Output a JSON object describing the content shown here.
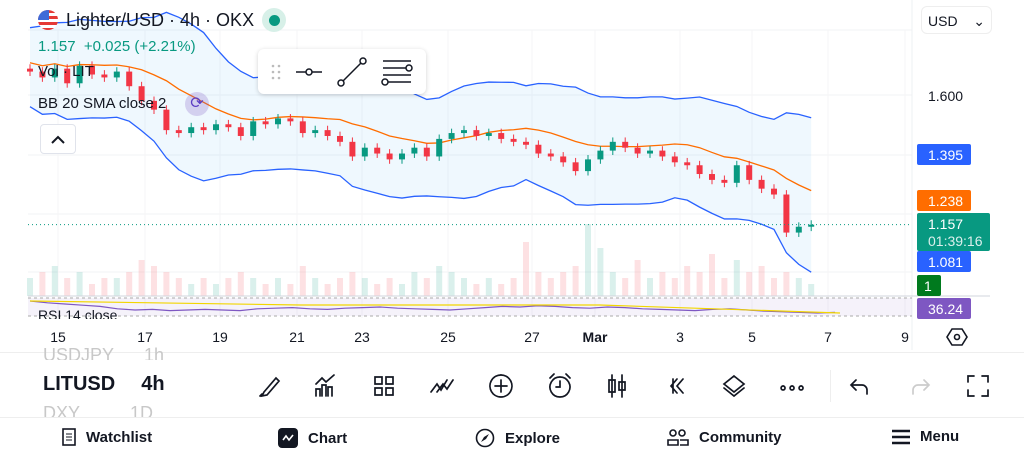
{
  "header": {
    "title": "Lighter/USD · 4h · OKX",
    "price_line": "1.157  +0.025 (+2.21%)",
    "currency": "USD"
  },
  "legends": {
    "volume": "Vol · LIT",
    "bb": "BB 20 SMA close 2",
    "rsi": "RSI 14 close"
  },
  "price_axis": {
    "labels": [
      "1.600"
    ],
    "tags": {
      "bb_upper": "1.395",
      "bb_basis": "1.238",
      "last": "1.157",
      "countdown": "01:39:16",
      "bb_lower": "1.081",
      "volume": "1",
      "rsi": "36.24"
    }
  },
  "colors": {
    "up": "#089981",
    "down": "#f23645",
    "bb_upper": "#2962ff",
    "basis": "#ff6d00",
    "rsi": "#7e57c2",
    "volume_tag": "#007a1e"
  },
  "time_axis": [
    "15",
    "17",
    "19",
    "21",
    "23",
    "25",
    "27",
    "Mar",
    "3",
    "5",
    "7",
    "9"
  ],
  "symbols": {
    "prev": "USDJPY",
    "prev_tf": "1h",
    "current": "LITUSD",
    "current_tf": "4h",
    "next": "DXY",
    "next_tf": "1D"
  },
  "nav": [
    {
      "label": "Watchlist"
    },
    {
      "label": "Chart"
    },
    {
      "label": "Explore"
    },
    {
      "label": "Community"
    },
    {
      "label": "Menu"
    }
  ],
  "chart_data": {
    "type": "candlestick",
    "price_range": [
      1.05,
      1.66
    ],
    "closes": [
      1.68,
      1.66,
      1.69,
      1.64,
      1.7,
      1.67,
      1.66,
      1.68,
      1.63,
      1.58,
      1.55,
      1.48,
      1.47,
      1.49,
      1.48,
      1.5,
      1.49,
      1.46,
      1.51,
      1.5,
      1.52,
      1.51,
      1.47,
      1.48,
      1.46,
      1.44,
      1.39,
      1.42,
      1.4,
      1.38,
      1.4,
      1.42,
      1.39,
      1.45,
      1.47,
      1.48,
      1.46,
      1.47,
      1.45,
      1.44,
      1.43,
      1.4,
      1.39,
      1.37,
      1.34,
      1.38,
      1.41,
      1.44,
      1.42,
      1.4,
      1.41,
      1.39,
      1.37,
      1.36,
      1.33,
      1.31,
      1.3,
      1.36,
      1.31,
      1.28,
      1.26,
      1.13,
      1.15,
      1.157
    ],
    "volumes": [
      3,
      4,
      5,
      3,
      4,
      2,
      3,
      3,
      4,
      6,
      5,
      4,
      3,
      2,
      3,
      2,
      3,
      4,
      3,
      2,
      3,
      2,
      5,
      3,
      2,
      3,
      4,
      3,
      2,
      3,
      2,
      4,
      3,
      5,
      4,
      3,
      2,
      3,
      2,
      3,
      9,
      4,
      3,
      4,
      5,
      12,
      8,
      4,
      3,
      6,
      3,
      4,
      3,
      5,
      4,
      7,
      3,
      6,
      4,
      5,
      3,
      4,
      3,
      2
    ],
    "rsi": [
      55,
      52,
      50,
      48,
      46,
      42,
      40,
      41,
      39,
      40,
      41,
      40,
      39,
      42,
      43,
      44,
      42,
      41,
      43,
      44,
      45,
      43,
      42,
      41,
      40,
      42,
      44,
      46,
      45,
      47,
      46,
      44,
      43,
      45,
      44,
      42,
      41,
      40,
      39,
      41,
      42,
      40,
      38,
      37,
      36,
      35,
      36
    ]
  }
}
